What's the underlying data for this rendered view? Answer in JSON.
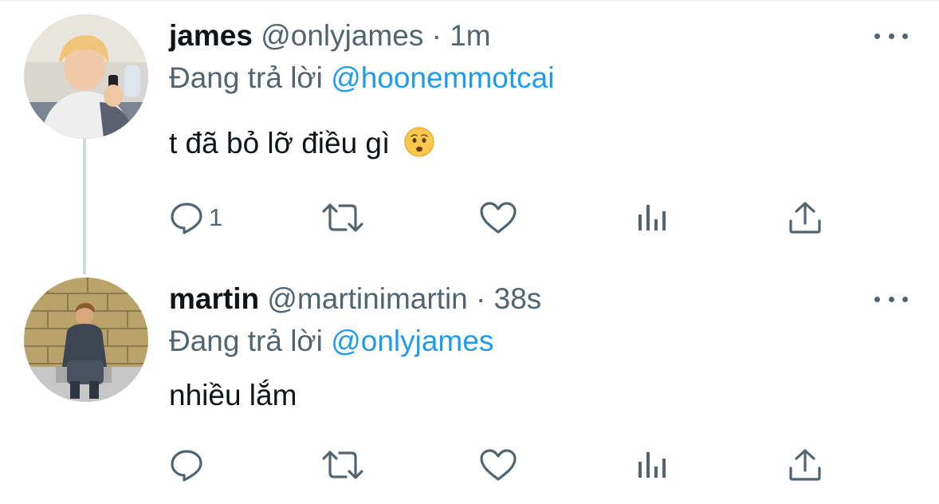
{
  "tweets": [
    {
      "name": "james",
      "handle": "@onlyjames",
      "separator": "·",
      "time": "1m",
      "reply_prefix": "Đang trả lời",
      "reply_to": "@hoonemmotcai",
      "text": "t đã bỏ lỡ điều gì",
      "emoji": "anxious-face-emoji",
      "reply_count": "1"
    },
    {
      "name": "martin",
      "handle": "@martinimartin",
      "separator": "·",
      "time": "38s",
      "reply_prefix": "Đang trả lời",
      "reply_to": "@onlyjames",
      "text": "nhiều lắm",
      "reply_count": ""
    }
  ],
  "icons": {
    "more": "more-horizontal-icon",
    "reply": "reply-bubble-icon",
    "retweet": "retweet-icon",
    "like": "heart-icon",
    "views": "views-bar-chart-icon",
    "share": "share-icon"
  },
  "colors": {
    "text": "#0f1419",
    "secondary": "#536471",
    "link": "#1d9bf0",
    "thread_line": "#cfd9de"
  }
}
